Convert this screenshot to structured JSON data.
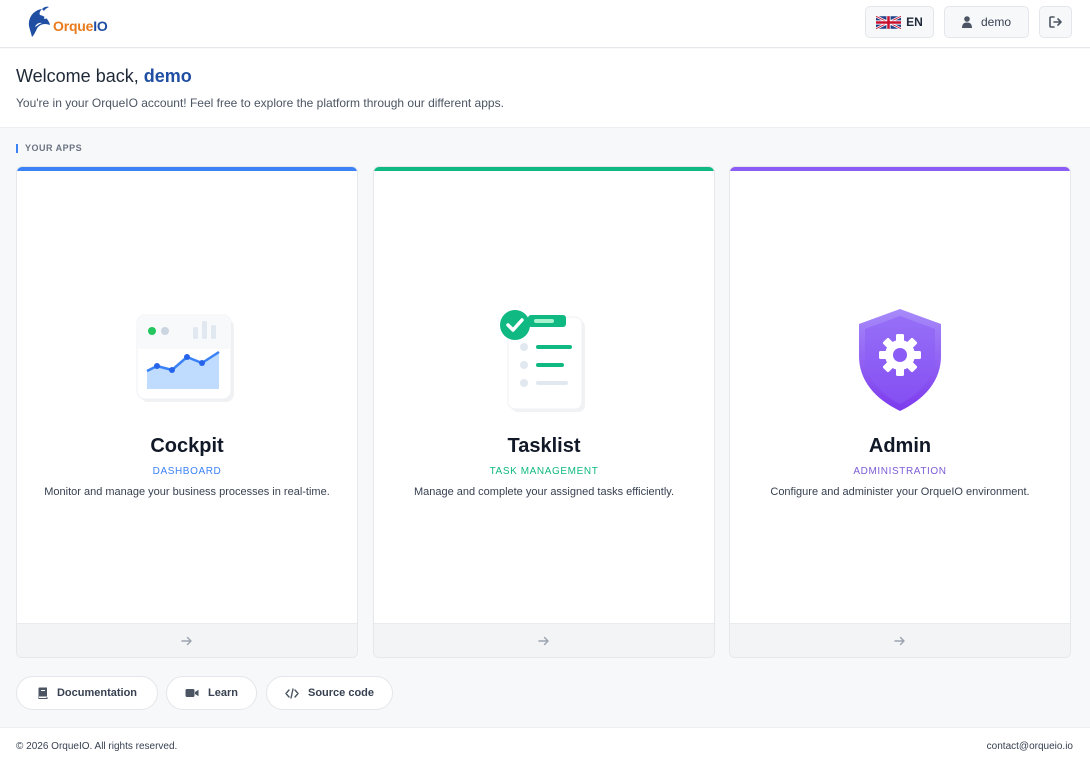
{
  "brand": {
    "name_part1": "Orque",
    "name_part2": "IO",
    "primary_color": "#1f4ea3",
    "secondary_color": "#e87b1e"
  },
  "header": {
    "language": {
      "code": "EN",
      "flag_icon": "uk-flag-icon"
    },
    "user": {
      "name": "demo",
      "icon": "user-icon"
    },
    "logout_icon": "logout-icon"
  },
  "welcome": {
    "greeting": "Welcome back,",
    "username": "demo",
    "message": "You're in your OrqueIO account! Feel free to explore the platform through our different apps."
  },
  "apps_section": {
    "label": "YOUR APPS",
    "apps": [
      {
        "title": "Cockpit",
        "subtitle": "DASHBOARD",
        "description": "Monitor and manage your business processes in real-time.",
        "accent_color": "#3b82f6",
        "icon": "dashboard-chart-icon",
        "arrow_icon": "arrow-right-icon"
      },
      {
        "title": "Tasklist",
        "subtitle": "TASK MANAGEMENT",
        "description": "Manage and complete your assigned tasks efficiently.",
        "accent_color": "#10b981",
        "icon": "checklist-icon",
        "arrow_icon": "arrow-right-icon"
      },
      {
        "title": "Admin",
        "subtitle": "ADMINISTRATION",
        "description": "Configure and administer your OrqueIO environment.",
        "accent_color": "#8b5cf6",
        "icon": "shield-gear-icon",
        "arrow_icon": "arrow-right-icon"
      }
    ]
  },
  "links": [
    {
      "label": "Documentation",
      "icon": "book-icon"
    },
    {
      "label": "Learn",
      "icon": "video-icon"
    },
    {
      "label": "Source code",
      "icon": "code-icon"
    }
  ],
  "footer": {
    "copyright": "© 2026 OrqueIO. All rights reserved.",
    "contact": "contact@orqueio.io"
  }
}
